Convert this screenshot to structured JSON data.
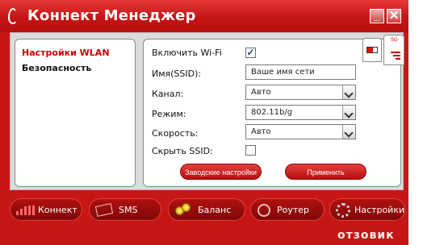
{
  "window": {
    "title": "Коннект Менеджер",
    "minimize_symbol": "_",
    "close_symbol": "✕"
  },
  "sidebar": {
    "items": [
      {
        "label": "Настройки WLAN",
        "active": true
      },
      {
        "label": "Безопасность",
        "active": false
      }
    ]
  },
  "side_tabs": {
    "tab_b_label": "SG"
  },
  "form": {
    "wifi_label": "Включить Wi-Fi",
    "wifi_enabled": true,
    "check_glyph": "✓",
    "ssid_label": "Имя(SSID):",
    "ssid_value": "Ваше имя сети",
    "channel_label": "Канал:",
    "channel_value": "Авто",
    "mode_label": "Режим:",
    "mode_value": "802.11b/g",
    "speed_label": "Скорость:",
    "speed_value": "Авто",
    "hide_ssid_label": "Скрыть SSID:",
    "hide_ssid": false
  },
  "actions": {
    "defaults_label": "Заводские настройки",
    "apply_label": "Применить"
  },
  "bottom_nav": {
    "connect": "Коннект",
    "sms": "SMS",
    "balance": "Баланс",
    "router": "Роутер",
    "settings": "Настройки"
  },
  "watermark": "отзовик",
  "colors": {
    "brand_red": "#c81616",
    "active_nav": "#cc0000"
  },
  "icons": [
    "vodafone-logo-icon",
    "battery-icon",
    "signal-icon",
    "signal-bars-icon",
    "envelope-icon",
    "coins-icon",
    "router-icon",
    "gear-icon"
  ]
}
